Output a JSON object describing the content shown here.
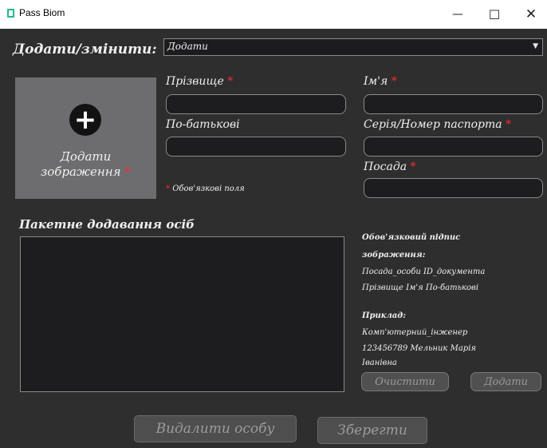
{
  "window": {
    "title": "Pass Biom",
    "minimize_glyph": "—",
    "maximize_glyph": "☐",
    "close_glyph": "✕"
  },
  "mode": {
    "label": "Додати/змінити:",
    "selected": "Додати"
  },
  "image_upload": {
    "label_line1": "Додати",
    "label_line2": "зображення",
    "required_mark": "*",
    "icon": "plus-circle-icon"
  },
  "fields": {
    "surname": {
      "label": "Прізвище",
      "value": ""
    },
    "name": {
      "label": "Ім'я",
      "value": ""
    },
    "patronymic": {
      "label": "По-батькові",
      "value": ""
    },
    "passport": {
      "label": "Серія/Номер паспорта",
      "value": ""
    },
    "position": {
      "label": "Посада",
      "value": ""
    },
    "required_mark": "*"
  },
  "required_note": "Обов'язкові поля",
  "batch": {
    "title": "Пакетне додавання осіб",
    "value": ""
  },
  "info": {
    "caption_line1": "Обов'язковий підпис",
    "caption_line2": "зображення:",
    "format_line1": "Посада_особи ID_документа",
    "format_line2": "Прізвище Ім'я По-батькові",
    "example_title": "Приклад:",
    "example_line1": "Комп'ютерний_інженер",
    "example_line2": "123456789 Мельник Марія",
    "example_line3": "Іванівна"
  },
  "buttons": {
    "clear": "Очистити",
    "add": "Додати",
    "delete_person": "Видалити особу",
    "save": "Зберегти"
  },
  "colors": {
    "background": "#2e2e2f",
    "input_bg": "#1d1d1f",
    "required": "#ff2a2a",
    "image_box": "#6d6d6f"
  }
}
